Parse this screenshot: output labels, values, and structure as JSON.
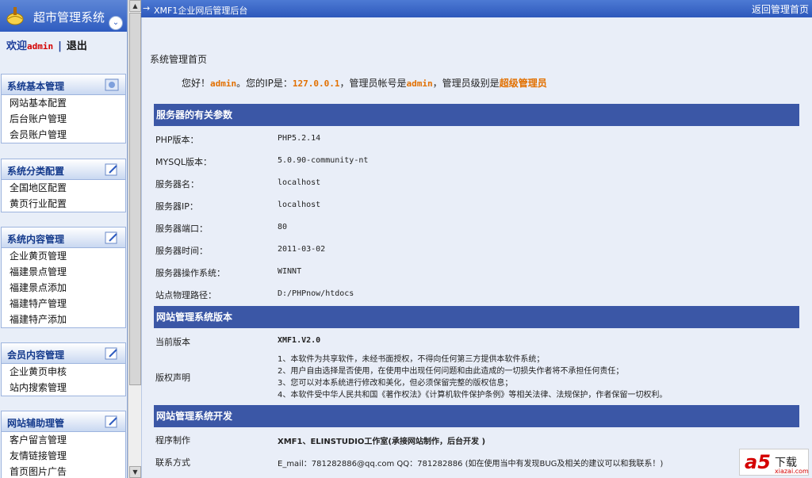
{
  "sidebar": {
    "title": "超市管理系统",
    "welcome_label": "欢迎",
    "username": "admin",
    "separator": "|",
    "logout": "退出",
    "collapse_glyph": "⌄",
    "groups": [
      {
        "title": "系统基本管理",
        "items": [
          "网站基本配置",
          "后台账户管理",
          "会员账户管理"
        ]
      },
      {
        "title": "系统分类配置",
        "items": [
          "全国地区配置",
          "黄页行业配置"
        ]
      },
      {
        "title": "系统内容管理",
        "items": [
          "企业黄页管理",
          "福建景点管理",
          "福建景点添加",
          "福建特产管理",
          "福建特产添加"
        ]
      },
      {
        "title": "会员内容管理",
        "items": [
          "企业黄页申核",
          "站内搜索管理"
        ]
      },
      {
        "title": "网站辅助理管",
        "items": [
          "客户留言管理",
          "友情链接管理",
          "首页图片广告"
        ]
      }
    ]
  },
  "topbar": {
    "arrow": "→",
    "title": "XMF1企业网后管理后台",
    "back_link": "返回管理首页"
  },
  "main": {
    "page_title": "系统管理首页",
    "greeting": {
      "hello": "您好！",
      "username": "admin",
      "ip_label": "。您的IP是：",
      "ip": "127.0.0.1",
      "account_label": "，管理员帐号是",
      "account": "admin",
      "level_label": "，管理员级别是",
      "level": "超级管理员"
    },
    "server_section": {
      "title": "服务器的有关参数",
      "rows": [
        {
          "label": "PHP版本：",
          "value": "PHP5.2.14"
        },
        {
          "label": "MYSQL版本：",
          "value": "5.0.90-community-nt"
        },
        {
          "label": "服务器名：",
          "value": "localhost"
        },
        {
          "label": "服务器IP：",
          "value": "localhost"
        },
        {
          "label": "服务器端口：",
          "value": "80"
        },
        {
          "label": "服务器时间：",
          "value": "2011-03-02"
        },
        {
          "label": "服务器操作系统：",
          "value": "WINNT"
        },
        {
          "label": "站点物理路径：",
          "value": "D:/PHPnow/htdocs"
        }
      ]
    },
    "version_section": {
      "title": "网站管理系统版本",
      "current_label": "当前版本",
      "current_value": "XMF1.V2.0",
      "copyright_label": "版权声明",
      "copyright_lines": [
        "1、本软件为共享软件，未经书面授权，不得向任何第三方提供本软件系统；",
        "2、用户自由选择是否使用，在使用中出现任何问题和由此造成的一切损失作者将不承担任何责任；",
        "3、您可以对本系统进行修改和美化，但必须保留完整的版权信息；",
        "4、本软件受中华人民共和国《著作权法》《计算机软件保护条例》等相关法律、法规保护，作者保留一切权利。"
      ]
    },
    "dev_section": {
      "title": "网站管理系统开发",
      "maker_label": "程序制作",
      "maker_value": "XMF1、ELINSTUDIO工作室(承接网站制作，后台开发 )",
      "contact_label": "联系方式",
      "contact_value": "E_mail：781282886@qq.com QQ：781282886 (如在使用当中有发现BUG及相关的建议可以和我联系！)"
    }
  },
  "watermark": {
    "mark": "a5",
    "text": "下载",
    "url": "xiazai.com"
  },
  "colors": {
    "header_blue": "#2f5cc0",
    "section_blue": "#3b57a6",
    "accent_orange": "#e27000",
    "admin_red": "#d40000"
  }
}
